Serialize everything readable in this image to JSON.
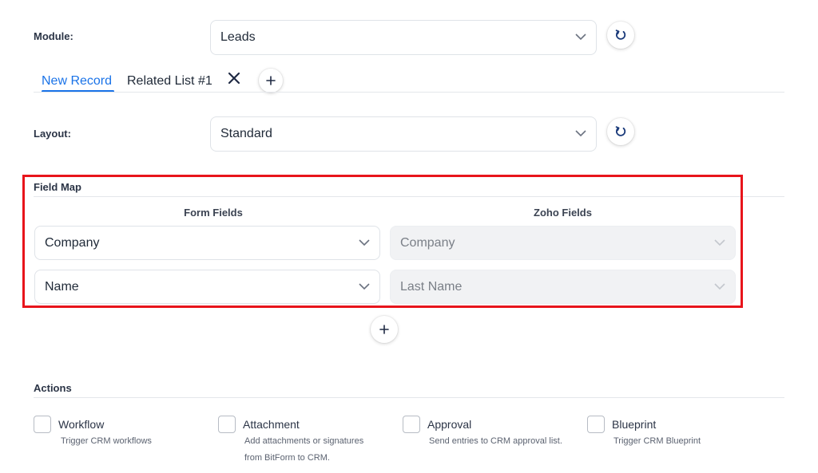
{
  "module": {
    "label": "Module:",
    "value": "Leads"
  },
  "tabs": [
    {
      "label": "New Record",
      "active": true
    },
    {
      "label": "Related List #1",
      "active": false
    }
  ],
  "layout": {
    "label": "Layout:",
    "value": "Standard"
  },
  "field_map": {
    "title": "Field Map",
    "form_fields_header": "Form Fields",
    "zoho_fields_header": "Zoho Fields",
    "rows": [
      {
        "form_field": "Company",
        "zoho_field": "Company"
      },
      {
        "form_field": "Name",
        "zoho_field": "Last Name"
      }
    ]
  },
  "actions": {
    "title": "Actions",
    "items": [
      {
        "title": "Workflow",
        "desc_line1": "Trigger CRM workflows",
        "desc_line2": ""
      },
      {
        "title": "Attachment",
        "desc_line1": "Add attachments or signatures",
        "desc_line2": "from BitForm to CRM."
      },
      {
        "title": "Approval",
        "desc_line1": "Send entries to CRM approval list.",
        "desc_line2": ""
      },
      {
        "title": "Blueprint",
        "desc_line1": "Trigger CRM Blueprint",
        "desc_line2": ""
      }
    ]
  },
  "icons": {
    "refresh": "refresh-icon",
    "chevron": "chevron-down-icon",
    "close": "close-icon",
    "add": "plus-icon"
  },
  "colors": {
    "accent": "#1a73e8",
    "highlight": "#e8141b"
  }
}
